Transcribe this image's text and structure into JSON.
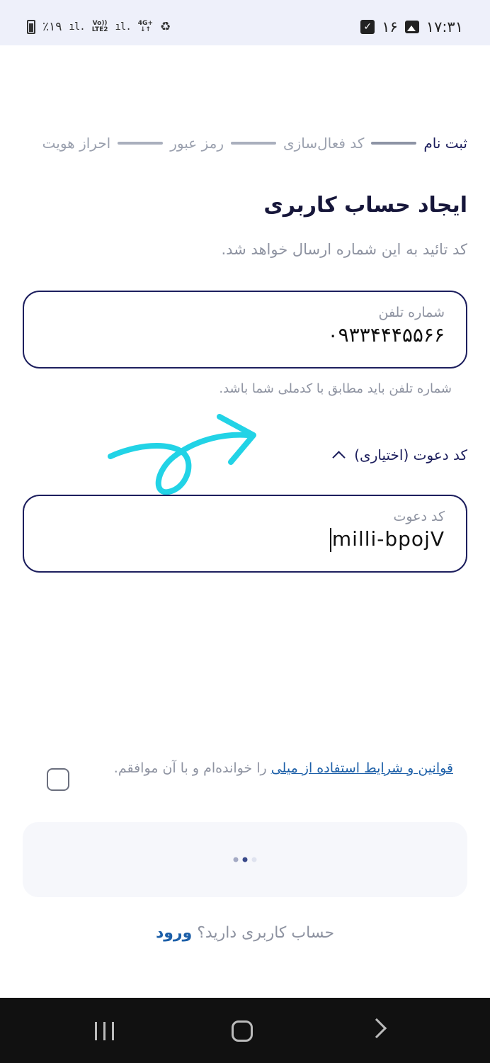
{
  "status_bar": {
    "battery_percent": "٪۱۹",
    "net_vo": "Vo))",
    "net_lte": "LTE2",
    "net_4g": "4G+",
    "notification_count": "۱۶",
    "time": "۱۷:۳۱"
  },
  "stepper": {
    "steps": [
      {
        "label": "ثبت نام"
      },
      {
        "label": "کد فعال‌سازی"
      },
      {
        "label": "رمز عبور"
      },
      {
        "label": "احراز هویت"
      }
    ]
  },
  "header": {
    "title": "ایجاد حساب کاربری",
    "subtitle": "کد تائید به این شماره ارسال خواهد شد."
  },
  "phone_field": {
    "label": "شماره تلفن",
    "value": "۰۹۳۳۴۴۴۵۵۶۶"
  },
  "phone_hint": "شماره تلفن باید مطابق با کدملی شما باشد.",
  "invite_toggle": {
    "label": "کد دعوت (اختیاری)"
  },
  "invite_field": {
    "label": "کد دعوت",
    "value": "milli-bpojV"
  },
  "terms": {
    "link_text": "قوانین و شرایط استفاده از میلی",
    "rest_text": " را خوانده‌ام و با آن موافقم."
  },
  "login": {
    "question": "حساب کاربری دارید؟",
    "link": "ورود"
  },
  "colors": {
    "primary": "#1d1f5e",
    "link": "#1c5fa8",
    "muted": "#8e93a1",
    "doodle": "#22d3e6"
  }
}
